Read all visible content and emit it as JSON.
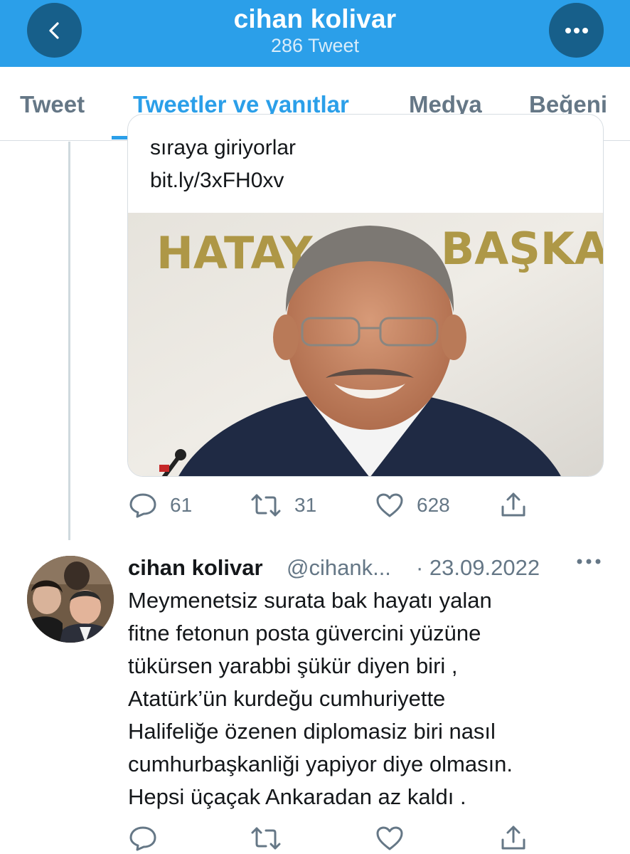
{
  "header": {
    "title": "cihan kolivar",
    "subtitle": "286 Tweet",
    "back_icon": "chevron-left-icon",
    "more_icon": "ellipsis-icon",
    "color": "#2b9fe9"
  },
  "tabs": [
    {
      "label": "Tweet",
      "active": false
    },
    {
      "label": "Tweetler ve yanıtlar",
      "active": true
    },
    {
      "label": "Medya",
      "active": false
    },
    {
      "label": "Beğeni",
      "active": false
    }
  ],
  "tweet1": {
    "card": {
      "text_lines": [
        "sıraya giriyorlar",
        "bit.ly/3xFH0xv"
      ],
      "image_sign_text": [
        "HATAY",
        "BAŞKA"
      ]
    },
    "actions": {
      "reply_count": "61",
      "retweet_count": "31",
      "like_count": "628"
    }
  },
  "tweet2": {
    "name": "cihan kolivar",
    "handle": "@cihank...",
    "date": "· 23.09.2022",
    "lines": [
      "Meymenetsiz surata bak hayatı yalan",
      "fitne  fetonun posta güvercini yüzüne",
      "tükürsen yarabbi şükür diyen biri ,",
      "Atatürk’ün kurdeğu cumhuriyette",
      "Halifeliğe özenen diplomasiz biri nasıl",
      "cumhurbaşkanliği yapiyor diye olmasın.",
      "Hepsi üçaçak Ankaradan az kaldı ."
    ]
  }
}
